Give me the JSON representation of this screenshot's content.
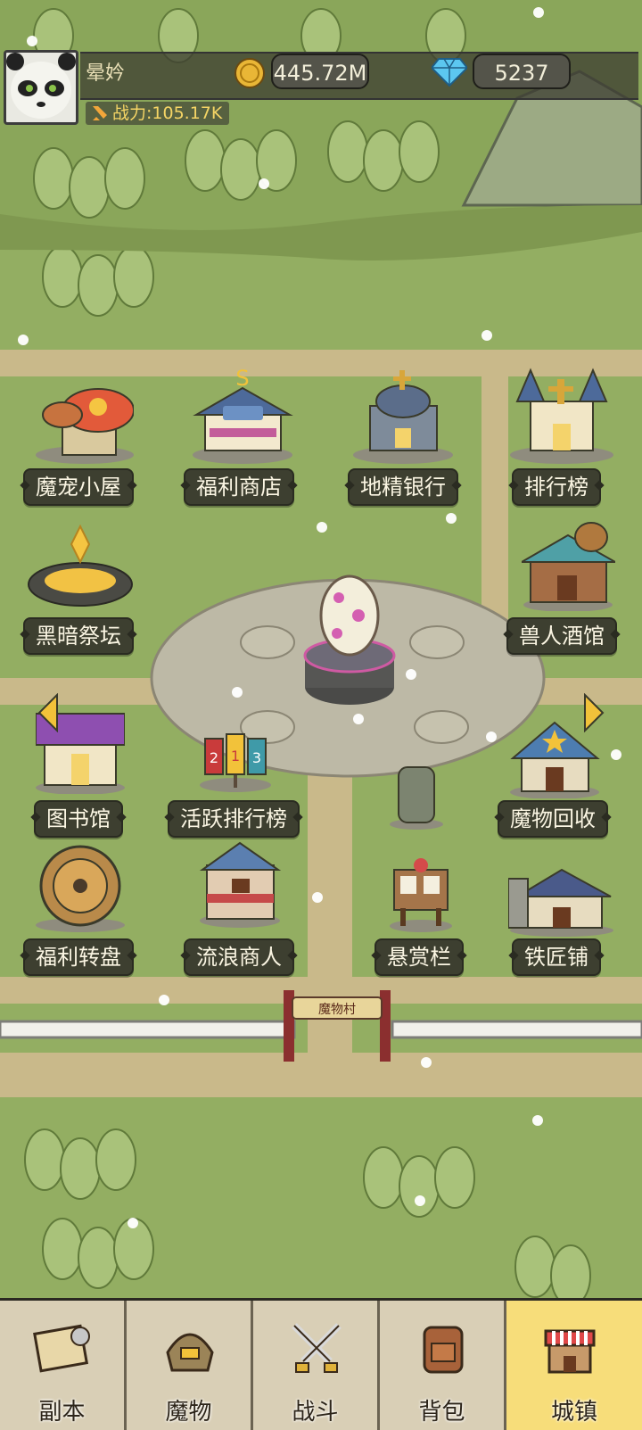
{
  "player": {
    "name": "晕妗",
    "power": "战力:105.17K",
    "gold": "445.72M",
    "gems": "5237"
  },
  "village_sign": "魔物村",
  "buildings": [
    {
      "label": "魔宠小屋",
      "icon": "mushroom-house-icon"
    },
    {
      "label": "福利商店",
      "icon": "shop-icon"
    },
    {
      "label": "地精银行",
      "icon": "bank-icon"
    },
    {
      "label": "排行榜",
      "icon": "castle-icon"
    },
    {
      "label": "黑暗祭坛",
      "icon": "altar-icon"
    },
    {
      "label": "兽人酒馆",
      "icon": "tavern-icon"
    },
    {
      "label": "图书馆",
      "icon": "library-icon"
    },
    {
      "label": "活跃排行榜",
      "icon": "ranking-banner-icon"
    },
    {
      "label": "魔物回收",
      "icon": "recycle-house-icon"
    },
    {
      "label": "福利转盘",
      "icon": "wheel-icon"
    },
    {
      "label": "流浪商人",
      "icon": "merchant-icon"
    },
    {
      "label": "悬赏栏",
      "icon": "bounty-board-icon"
    },
    {
      "label": "铁匠铺",
      "icon": "smithy-icon"
    }
  ],
  "banner_numbers": [
    "2",
    "1",
    "3"
  ],
  "nav": {
    "tabs": [
      {
        "label": "副本",
        "icon": "map-scroll-icon",
        "active": false
      },
      {
        "label": "魔物",
        "icon": "monster-helmet-icon",
        "active": false
      },
      {
        "label": "战斗",
        "icon": "crossed-swords-icon",
        "active": false
      },
      {
        "label": "背包",
        "icon": "backpack-icon",
        "active": false
      },
      {
        "label": "城镇",
        "icon": "town-shop-icon",
        "active": true
      }
    ]
  },
  "colors": {
    "grass": "#8aa85a",
    "path": "#c9b98a",
    "label_bg": "#3d3f30",
    "active_tab": "#f7dd7a",
    "tab_bg": "#d9cfb6"
  }
}
